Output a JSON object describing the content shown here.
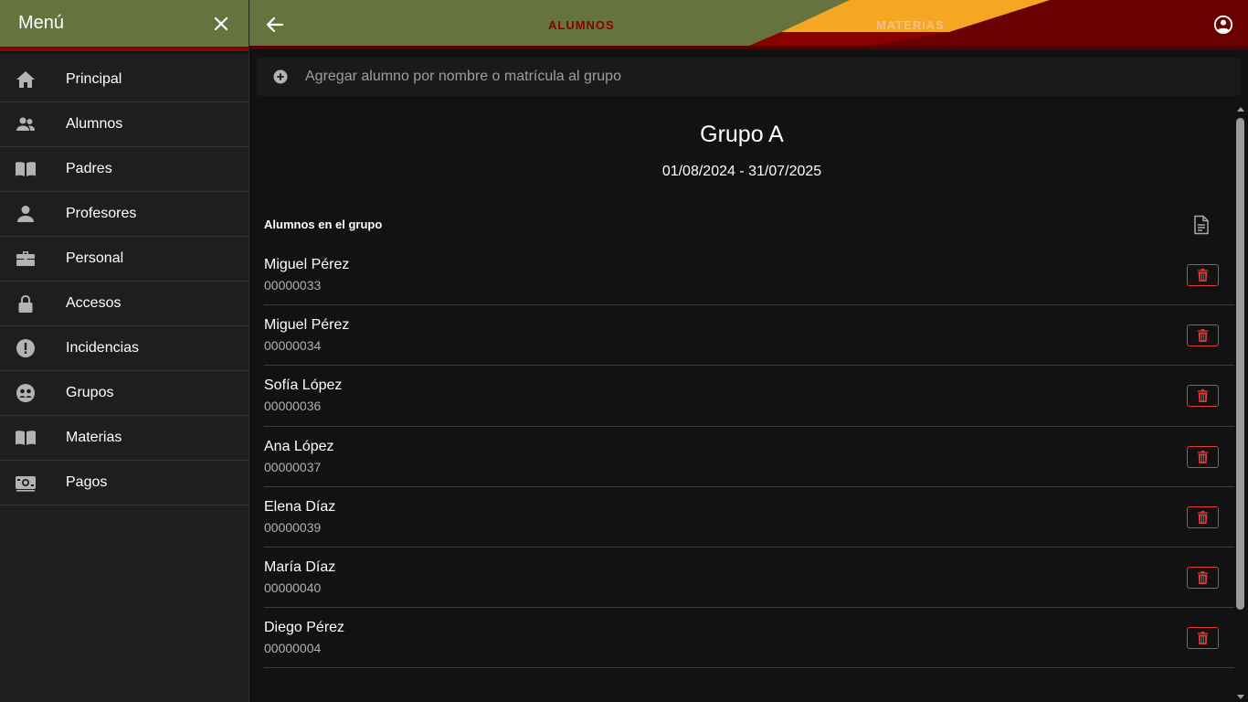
{
  "sidebar": {
    "title": "Menú",
    "items": [
      {
        "label": "Principal",
        "icon": "home-icon"
      },
      {
        "label": "Alumnos",
        "icon": "people-icon"
      },
      {
        "label": "Padres",
        "icon": "book-icon"
      },
      {
        "label": "Profesores",
        "icon": "person-icon"
      },
      {
        "label": "Personal",
        "icon": "briefcase-icon"
      },
      {
        "label": "Accesos",
        "icon": "lock-icon"
      },
      {
        "label": "Incidencias",
        "icon": "alert-icon"
      },
      {
        "label": "Grupos",
        "icon": "group-icon"
      },
      {
        "label": "Materias",
        "icon": "book-icon"
      },
      {
        "label": "Pagos",
        "icon": "money-icon"
      }
    ]
  },
  "topbar": {
    "tabs": [
      {
        "label": "ALUMNOS",
        "active": true
      },
      {
        "label": "MATERIAS",
        "active": false
      }
    ]
  },
  "search": {
    "placeholder": "Agregar alumno por nombre o matrícula al grupo"
  },
  "group": {
    "title": "Grupo A",
    "dates": "01/08/2024 - 31/07/2025",
    "list_header": "Alumnos en el grupo",
    "students": [
      {
        "name": "Miguel Pérez",
        "id": "00000033"
      },
      {
        "name": "Miguel Pérez",
        "id": "00000034"
      },
      {
        "name": "Sofía López",
        "id": "00000036"
      },
      {
        "name": "Ana López",
        "id": "00000037"
      },
      {
        "name": "Elena Díaz",
        "id": "00000039"
      },
      {
        "name": "María Díaz",
        "id": "00000040"
      },
      {
        "name": "Diego Pérez",
        "id": "00000004"
      }
    ]
  },
  "colors": {
    "header_olive": "#66733f",
    "header_maroon": "#6b0000",
    "accent_orange": "#f5a623",
    "delete_red": "#e53935"
  }
}
